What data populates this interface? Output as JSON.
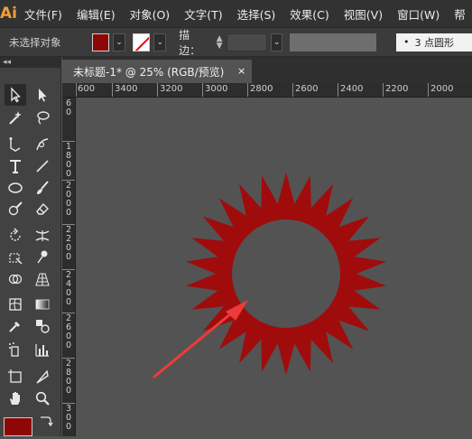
{
  "app": {
    "logo": "Ai"
  },
  "menu": [
    "文件(F)",
    "编辑(E)",
    "对象(O)",
    "文字(T)",
    "选择(S)",
    "效果(C)",
    "视图(V)",
    "窗口(W)",
    "帮"
  ],
  "control_bar": {
    "selection_label": "未选择对象",
    "fill_color": "#8e0707",
    "stroke_label": "描边：",
    "brush_label": "3 点圆形",
    "dropdown_arrow": "⌄"
  },
  "document_tab": {
    "title": "未标题-1* @ 25% (RGB/预览)",
    "close_glyph": "×"
  },
  "ruler": {
    "horizontal_labels": [
      "600",
      "3400",
      "3200",
      "3000",
      "2800",
      "2600",
      "2400",
      "2200",
      "2000"
    ],
    "vertical_labels": [
      "6 0",
      "1 8 0 0",
      "2 0 0 0",
      "2 2 0 0",
      "2 4 0 0",
      "2 6 0 0",
      "2 8 0 0",
      "3 0 0"
    ]
  },
  "toolbox": {
    "collapse_glyph": "◂◂"
  },
  "artwork": {
    "starburst_color": "#a00c0c",
    "arrow_color": "#ee3a3a",
    "points": 26
  }
}
